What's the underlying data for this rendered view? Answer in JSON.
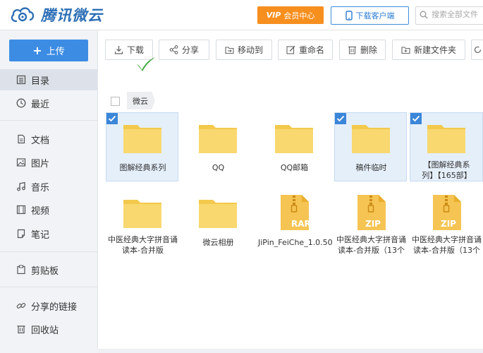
{
  "header": {
    "logo_text": "腾讯微云",
    "vip_badge": "VIP",
    "vip_label": "会员中心",
    "download_client": "下载客户端",
    "search_placeholder": "搜索全部文件"
  },
  "sidebar": {
    "upload_label": "上传",
    "items": [
      {
        "label": "目录",
        "icon": "list-icon",
        "active": true
      },
      {
        "label": "最近",
        "icon": "clock-icon"
      },
      {
        "label": "文档",
        "icon": "document-icon"
      },
      {
        "label": "图片",
        "icon": "image-icon"
      },
      {
        "label": "音乐",
        "icon": "music-icon"
      },
      {
        "label": "视频",
        "icon": "video-icon"
      },
      {
        "label": "笔记",
        "icon": "note-icon"
      },
      {
        "label": "剪贴板",
        "icon": "clipboard-icon"
      },
      {
        "label": "分享的链接",
        "icon": "link-icon"
      },
      {
        "label": "回收站",
        "icon": "trash-icon"
      }
    ]
  },
  "toolbar": {
    "download": "下载",
    "share": "分享",
    "move_to": "移动到",
    "rename": "重命名",
    "delete": "删除",
    "new_folder": "新建文件夹"
  },
  "breadcrumb": {
    "current": "微云"
  },
  "files": [
    {
      "name": "图解经典系列",
      "type": "folder",
      "selected": true
    },
    {
      "name": "QQ",
      "type": "folder",
      "selected": false
    },
    {
      "name": "QQ邮箱",
      "type": "folder",
      "selected": false
    },
    {
      "name": "稿件临时",
      "type": "folder",
      "selected": true
    },
    {
      "name": "【图解经典系列】【165部】",
      "line1": "【图解经典系",
      "line2": "列】【165部】",
      "type": "folder",
      "selected": true
    },
    {
      "name": "中医经典大字拼音诵读本-合并版",
      "line1": "中医经典大字拼音诵",
      "line2": "读本-合并版",
      "type": "folder",
      "selected": false
    },
    {
      "name": "微云相册",
      "type": "folder",
      "selected": false
    },
    {
      "name": "JiPin_FeiChe_1.0.50",
      "type": "rar",
      "badge": "RAR",
      "selected": false
    },
    {
      "name": "中医经典大字拼音诵读本-合并版（13个",
      "line1": "中医经典大字拼音诵",
      "line2": "读本-合并版（13个",
      "type": "zip",
      "badge": "ZIP",
      "selected": false
    },
    {
      "name": "中医经典大字拼音诵读本-合并版（13个",
      "line1": "中医经典大字拼音诵",
      "line2": "读本-合并版（13个",
      "type": "zip",
      "badge": "ZIP",
      "selected": false
    }
  ],
  "colors": {
    "accent": "#3d8ce3",
    "vip": "#f78f1e",
    "folder": "#f8d56b",
    "archive": "#f5c453"
  }
}
